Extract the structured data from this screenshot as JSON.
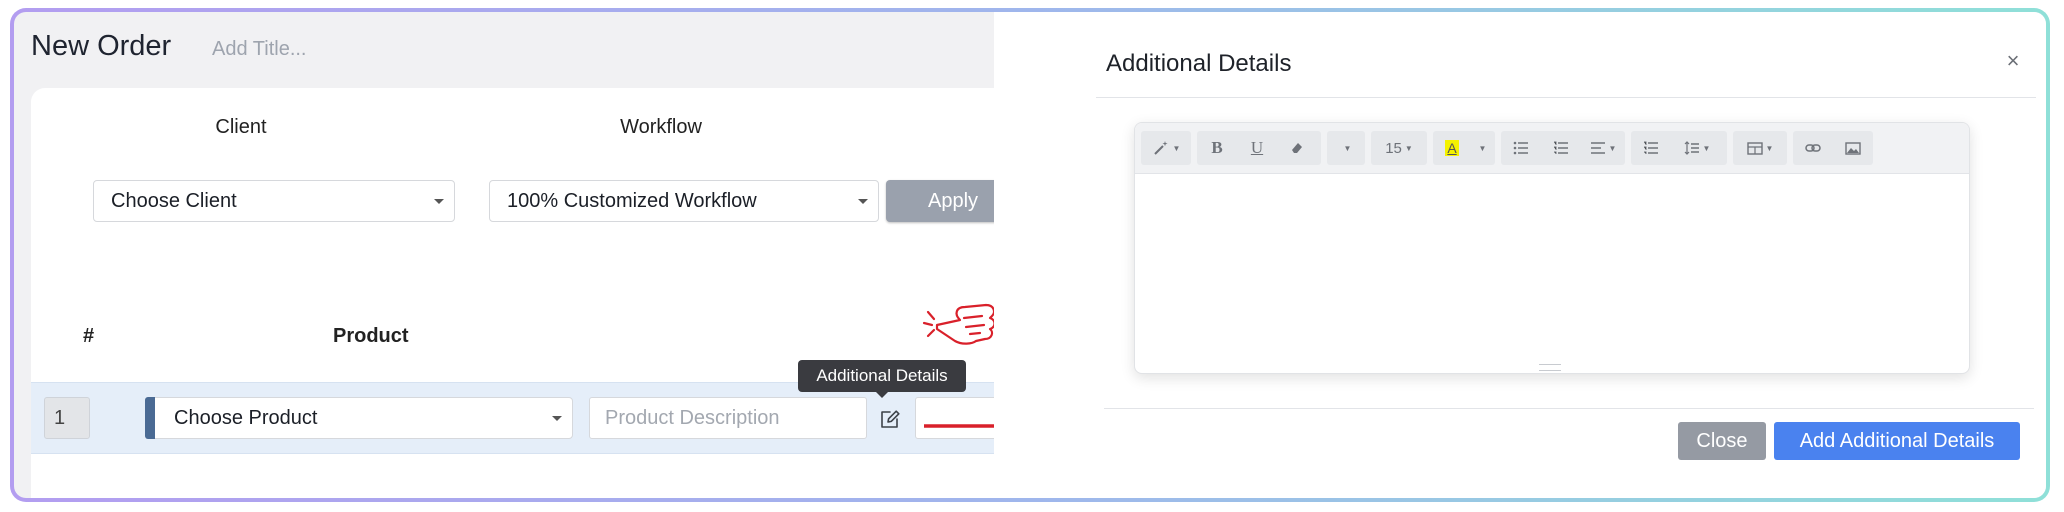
{
  "page": {
    "title": "New Order",
    "title_placeholder": "Add Title..."
  },
  "form": {
    "client_label": "Client",
    "client_value": "Choose Client",
    "workflow_label": "Workflow",
    "workflow_value": "100% Customized Workflow",
    "apply_label": "Apply"
  },
  "table": {
    "headers": {
      "number": "#",
      "product": "Product"
    },
    "rows": [
      {
        "number": "1",
        "product": "Choose Product",
        "description_placeholder": "Product Description"
      }
    ]
  },
  "tooltip": {
    "text": "Additional Details"
  },
  "modal": {
    "title": "Additional Details",
    "close_icon": "×",
    "toolbar": {
      "font_size": "15",
      "buttons": [
        "magic-icon",
        "bold-icon",
        "underline-icon",
        "eraser-icon",
        "font-family-dropdown",
        "font-size-dropdown",
        "highlight-icon",
        "unordered-list-icon",
        "ordered-list-icon",
        "align-icon",
        "line-height-icon",
        "table-icon",
        "picture-icon",
        "link-icon",
        "image-icon"
      ]
    },
    "close_button": "Close",
    "submit_button": "Add Additional Details"
  },
  "colors": {
    "accent_blue": "#4a82ef",
    "arrow_red": "#d9202a",
    "row_highlight": "#e5eef9",
    "apply_gray": "#9aa1ad"
  }
}
